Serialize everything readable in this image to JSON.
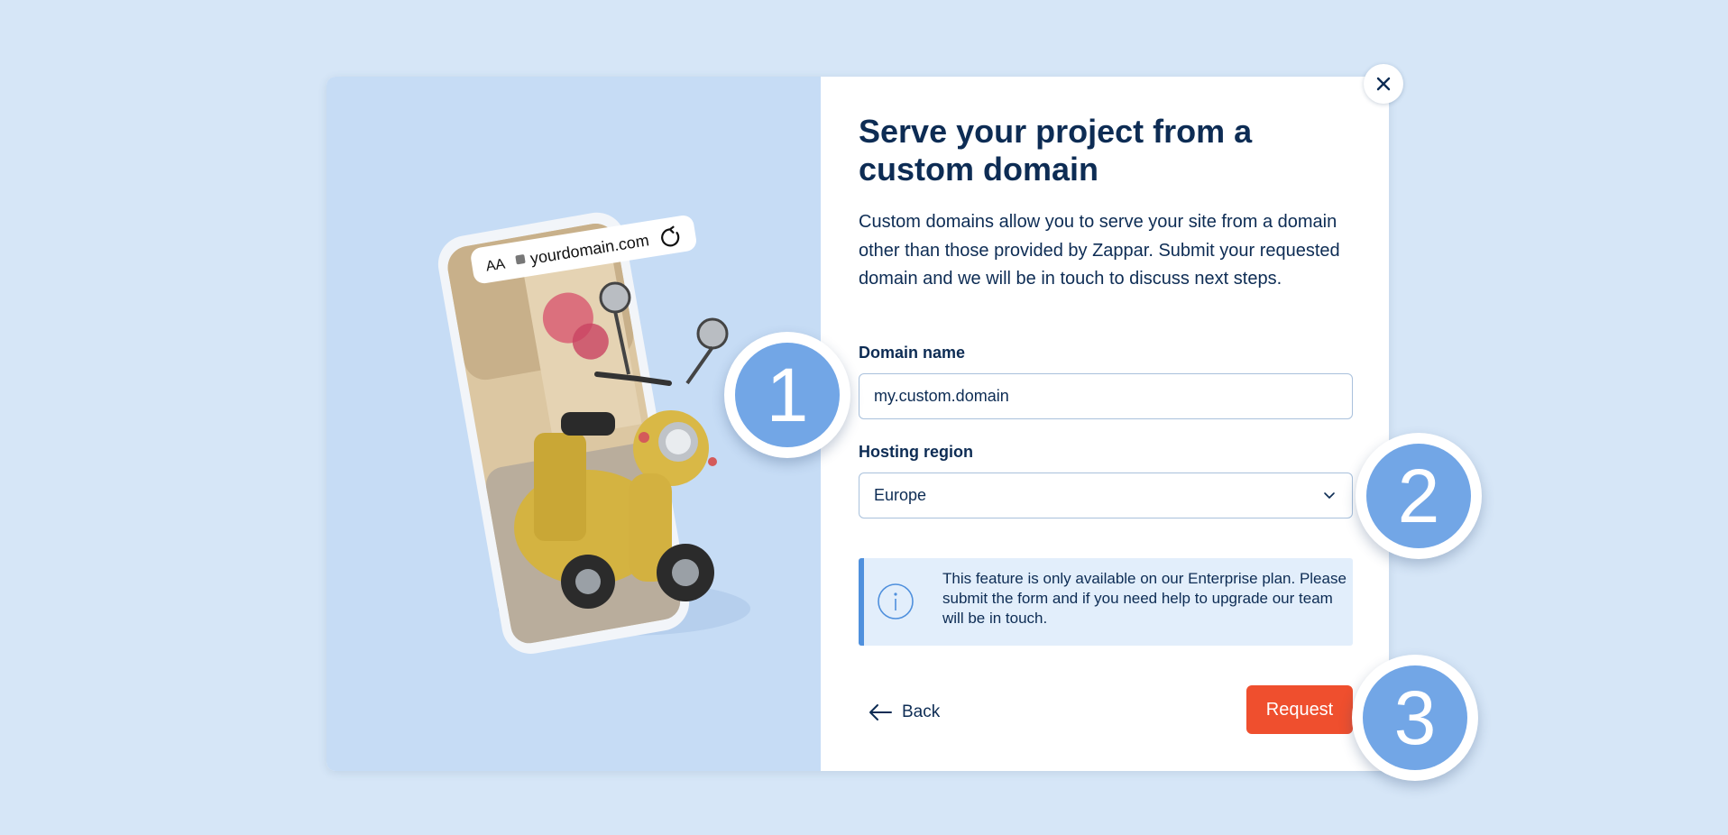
{
  "dialog": {
    "title": "Serve your project from a custom domain",
    "description": "Custom domains allow you to serve your site from a domain other than those provided by Zappar. Submit your requested domain and we will be in touch to discuss next steps.",
    "domain_label": "Domain name",
    "domain_value": "my.custom.domain",
    "region_label": "Hosting region",
    "region_value": "Europe",
    "info_text": "This feature is only available on our Enterprise plan. Please submit the form and if you need help to upgrade our team will be in touch.",
    "back_label": "Back",
    "request_label": "Request"
  },
  "illustration": {
    "address_bar_text_size": "AA",
    "address_bar_url": "yourdomain.com"
  },
  "badges": [
    "1",
    "2",
    "3"
  ],
  "icons": {
    "close": "close-icon",
    "chevron": "chevron-down-icon",
    "info": "info-icon",
    "back": "arrow-left-icon",
    "lock": "lock-icon",
    "refresh": "refresh-icon"
  },
  "colors": {
    "page_background": "#d6e6f7",
    "left_panel": "#c6dcf5",
    "heading": "#0d2c54",
    "accent": "#ef4f2e",
    "info_border": "#4f90dd",
    "info_background": "#e2eefb",
    "badge": "#72a6e6"
  }
}
